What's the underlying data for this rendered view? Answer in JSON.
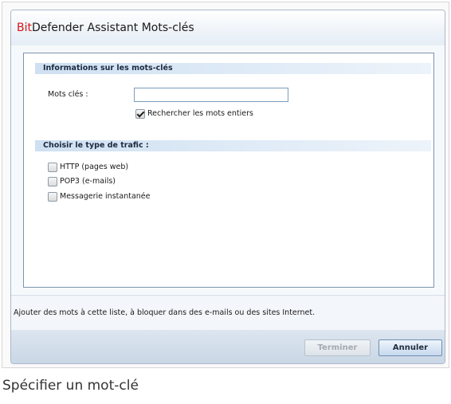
{
  "window": {
    "title_brand": "Bit",
    "title_rest": "Defender Assistant Mots-clés"
  },
  "keywords_section": {
    "header": "Informations sur les mots-clés",
    "keywords_label": "Mots clés :",
    "keywords_value": "",
    "whole_words_label": "Rechercher les mots entiers",
    "whole_words_checked": true
  },
  "traffic_section": {
    "header": "Choisir le type de trafic :",
    "options": [
      {
        "label": "HTTP (pages web)",
        "checked": false
      },
      {
        "label": "POP3 (e-mails)",
        "checked": false
      },
      {
        "label": "Messagerie instantanée",
        "checked": false
      }
    ]
  },
  "info": {
    "text": "Ajouter des mots à cette liste, à bloquer dans des e-mails ou des sites Internet."
  },
  "footer": {
    "finish_label": "Terminer",
    "cancel_label": "Annuler"
  },
  "caption": "Spécifier un mot-clé"
}
